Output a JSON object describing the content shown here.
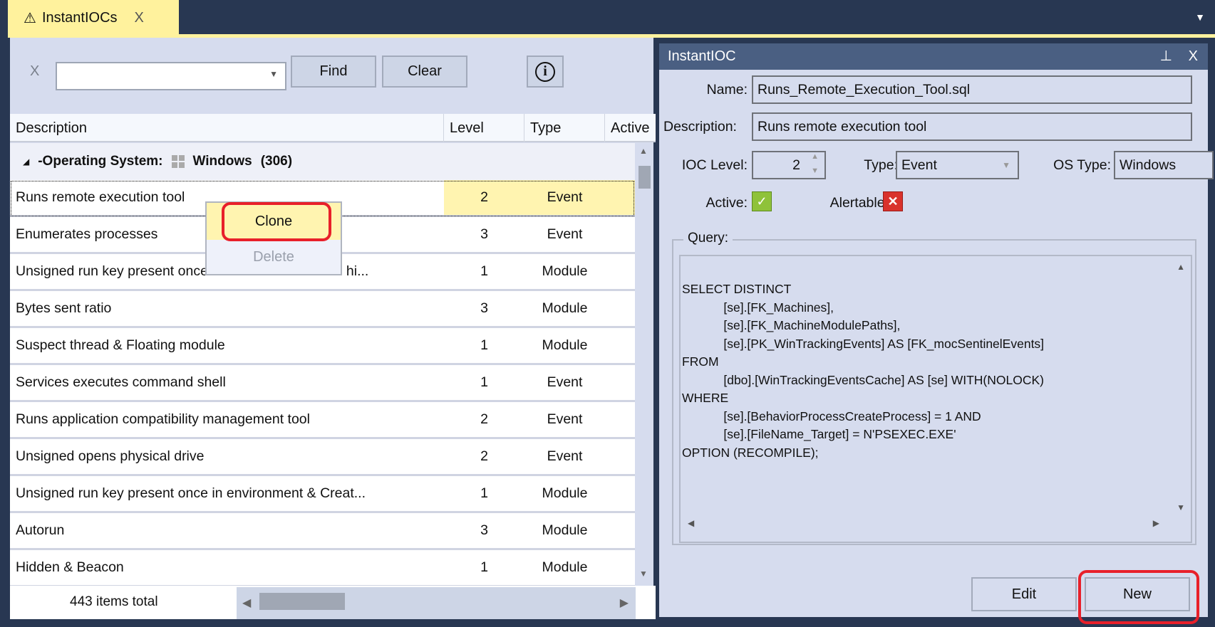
{
  "tab": {
    "title": "InstantIOCs",
    "icon": "warning-icon",
    "close": "X",
    "menu": "▼"
  },
  "toolbar": {
    "clear_x": "X",
    "search_value": "",
    "find": "Find",
    "clear": "Clear",
    "info": "i"
  },
  "grid": {
    "columns": [
      "Description",
      "Level",
      "Type",
      "Active"
    ],
    "group": {
      "label": "-Operating System:",
      "os": "Windows",
      "count": "(306)"
    },
    "rows": [
      {
        "description": "Runs remote execution tool",
        "level": "2",
        "type": "Event"
      },
      {
        "description": "Enumerates processes",
        "level": "3",
        "type": "Event"
      },
      {
        "description": "Unsigned run key present once in environment & File hi...",
        "level": "1",
        "type": "Module"
      },
      {
        "description": "Bytes sent ratio",
        "level": "3",
        "type": "Module"
      },
      {
        "description": "Suspect thread & Floating module",
        "level": "1",
        "type": "Module"
      },
      {
        "description": "Services executes command shell",
        "level": "1",
        "type": "Event"
      },
      {
        "description": "Runs application compatibility management tool",
        "level": "2",
        "type": "Event"
      },
      {
        "description": "Unsigned opens physical drive",
        "level": "2",
        "type": "Event"
      },
      {
        "description": "Unsigned run key present once in environment & Creat...",
        "level": "1",
        "type": "Module"
      },
      {
        "description": "Autorun",
        "level": "3",
        "type": "Module"
      },
      {
        "description": "Hidden & Beacon",
        "level": "1",
        "type": "Module"
      }
    ],
    "total": "443 items total"
  },
  "context_menu": {
    "clone": "Clone",
    "delete": "Delete"
  },
  "detail": {
    "title": "InstantIOC",
    "pin": "🖈",
    "close": "X",
    "name_label": "Name:",
    "name": "Runs_Remote_Execution_Tool.sql",
    "desc_label": "Description:",
    "description": "Runs remote execution tool",
    "level_label": "IOC Level:",
    "level": "2",
    "type_label": "Type:",
    "type": "Event",
    "os_label": "OS Type:",
    "os": "Windows",
    "active_label": "Active:",
    "active": true,
    "alertable_label": "Alertable:",
    "alertable": false,
    "query_label": "Query:",
    "query": "SELECT DISTINCT\n\t\t[se].[FK_Machines],\n\t\t[se].[FK_MachineModulePaths],\n\t\t[se].[PK_WinTrackingEvents] AS [FK_mocSentinelEvents]\nFROM\n\t\t[dbo].[WinTrackingEventsCache] AS [se] WITH(NOLOCK)\nWHERE\n\t\t[se].[BehaviorProcessCreateProcess] = 1 AND\n\t\t[se].[FileName_Target] = N'PSEXEC.EXE'\nOPTION (RECOMPILE);",
    "edit": "Edit",
    "new": "New"
  },
  "colors": {
    "tab": "#fff29d",
    "background": "#283752",
    "panel": "#d6dcee",
    "titlebar": "#4a5f82",
    "highlight": "#e8202a"
  }
}
